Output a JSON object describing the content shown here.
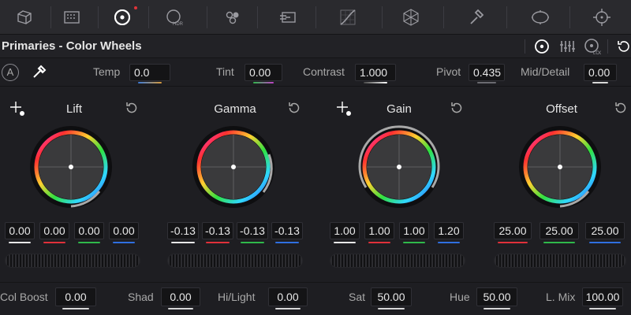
{
  "toolbar": {
    "tools": [
      {
        "name": "camera-raw-icon"
      },
      {
        "name": "color-match-icon"
      },
      {
        "name": "color-wheels-icon",
        "active": true
      },
      {
        "name": "hdr-icon",
        "label": "HDR"
      },
      {
        "name": "rgb-mixer-icon"
      },
      {
        "name": "motion-effects-icon"
      },
      {
        "name": "curves-icon"
      },
      {
        "name": "color-warper-icon"
      },
      {
        "name": "qualifier-icon"
      },
      {
        "name": "window-icon"
      },
      {
        "name": "tracker-icon"
      }
    ]
  },
  "header": {
    "title": "Primaries - Color Wheels"
  },
  "params": {
    "temp": {
      "label": "Temp",
      "value": "0.0"
    },
    "tint": {
      "label": "Tint",
      "value": "0.00"
    },
    "contrast": {
      "label": "Contrast",
      "value": "1.000"
    },
    "pivot": {
      "label": "Pivot",
      "value": "0.435"
    },
    "mid_detail": {
      "label": "Mid/Detail",
      "value": "0.00"
    },
    "auto_label": "A"
  },
  "wheels": [
    {
      "label": "Lift",
      "values": [
        "0.00",
        "0.00",
        "0.00",
        "0.00"
      ]
    },
    {
      "label": "Gamma",
      "values": [
        "-0.13",
        "-0.13",
        "-0.13",
        "-0.13"
      ]
    },
    {
      "label": "Gain",
      "values": [
        "1.00",
        "1.00",
        "1.00",
        "1.20"
      ]
    },
    {
      "label": "Offset",
      "values": [
        "25.00",
        "25.00",
        "25.00"
      ]
    }
  ],
  "bottom": {
    "col_boost": {
      "label": "Col Boost",
      "value": "0.00"
    },
    "shad": {
      "label": "Shad",
      "value": "0.00"
    },
    "hi_light": {
      "label": "Hi/Light",
      "value": "0.00"
    },
    "sat": {
      "label": "Sat",
      "value": "50.00"
    },
    "hue": {
      "label": "Hue",
      "value": "50.00"
    },
    "l_mix": {
      "label": "L. Mix",
      "value": "100.00"
    }
  },
  "colors": {
    "channel_white": "#e8e8e8",
    "channel_red": "#e0303a",
    "channel_green": "#2fb84a",
    "channel_blue": "#2f6fe0",
    "temp_gradient": "#3a7ad8",
    "tint_gradient": "#c040c8"
  }
}
